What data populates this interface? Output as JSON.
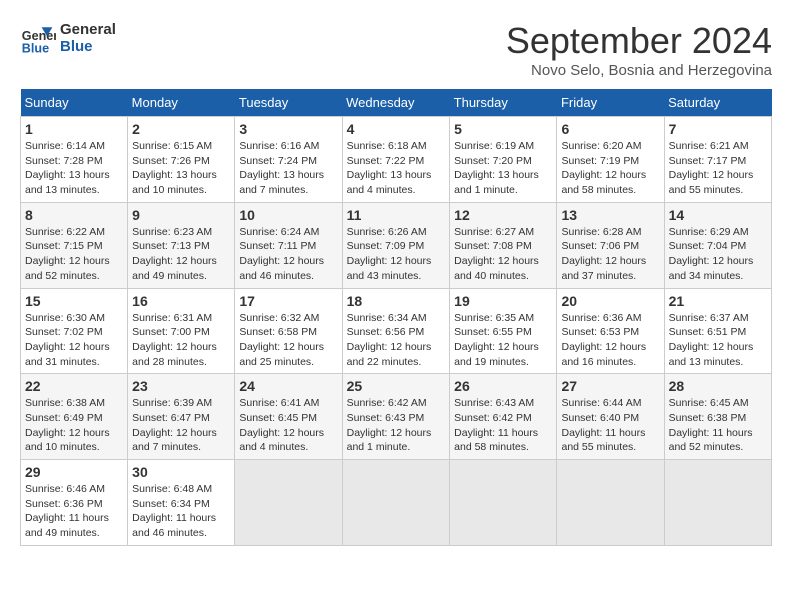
{
  "header": {
    "logo_general": "General",
    "logo_blue": "Blue",
    "title": "September 2024",
    "location": "Novo Selo, Bosnia and Herzegovina"
  },
  "weekdays": [
    "Sunday",
    "Monday",
    "Tuesday",
    "Wednesday",
    "Thursday",
    "Friday",
    "Saturday"
  ],
  "weeks": [
    [
      {
        "day": "1",
        "info": "Sunrise: 6:14 AM\nSunset: 7:28 PM\nDaylight: 13 hours\nand 13 minutes."
      },
      {
        "day": "2",
        "info": "Sunrise: 6:15 AM\nSunset: 7:26 PM\nDaylight: 13 hours\nand 10 minutes."
      },
      {
        "day": "3",
        "info": "Sunrise: 6:16 AM\nSunset: 7:24 PM\nDaylight: 13 hours\nand 7 minutes."
      },
      {
        "day": "4",
        "info": "Sunrise: 6:18 AM\nSunset: 7:22 PM\nDaylight: 13 hours\nand 4 minutes."
      },
      {
        "day": "5",
        "info": "Sunrise: 6:19 AM\nSunset: 7:20 PM\nDaylight: 13 hours\nand 1 minute."
      },
      {
        "day": "6",
        "info": "Sunrise: 6:20 AM\nSunset: 7:19 PM\nDaylight: 12 hours\nand 58 minutes."
      },
      {
        "day": "7",
        "info": "Sunrise: 6:21 AM\nSunset: 7:17 PM\nDaylight: 12 hours\nand 55 minutes."
      }
    ],
    [
      {
        "day": "8",
        "info": "Sunrise: 6:22 AM\nSunset: 7:15 PM\nDaylight: 12 hours\nand 52 minutes."
      },
      {
        "day": "9",
        "info": "Sunrise: 6:23 AM\nSunset: 7:13 PM\nDaylight: 12 hours\nand 49 minutes."
      },
      {
        "day": "10",
        "info": "Sunrise: 6:24 AM\nSunset: 7:11 PM\nDaylight: 12 hours\nand 46 minutes."
      },
      {
        "day": "11",
        "info": "Sunrise: 6:26 AM\nSunset: 7:09 PM\nDaylight: 12 hours\nand 43 minutes."
      },
      {
        "day": "12",
        "info": "Sunrise: 6:27 AM\nSunset: 7:08 PM\nDaylight: 12 hours\nand 40 minutes."
      },
      {
        "day": "13",
        "info": "Sunrise: 6:28 AM\nSunset: 7:06 PM\nDaylight: 12 hours\nand 37 minutes."
      },
      {
        "day": "14",
        "info": "Sunrise: 6:29 AM\nSunset: 7:04 PM\nDaylight: 12 hours\nand 34 minutes."
      }
    ],
    [
      {
        "day": "15",
        "info": "Sunrise: 6:30 AM\nSunset: 7:02 PM\nDaylight: 12 hours\nand 31 minutes."
      },
      {
        "day": "16",
        "info": "Sunrise: 6:31 AM\nSunset: 7:00 PM\nDaylight: 12 hours\nand 28 minutes."
      },
      {
        "day": "17",
        "info": "Sunrise: 6:32 AM\nSunset: 6:58 PM\nDaylight: 12 hours\nand 25 minutes."
      },
      {
        "day": "18",
        "info": "Sunrise: 6:34 AM\nSunset: 6:56 PM\nDaylight: 12 hours\nand 22 minutes."
      },
      {
        "day": "19",
        "info": "Sunrise: 6:35 AM\nSunset: 6:55 PM\nDaylight: 12 hours\nand 19 minutes."
      },
      {
        "day": "20",
        "info": "Sunrise: 6:36 AM\nSunset: 6:53 PM\nDaylight: 12 hours\nand 16 minutes."
      },
      {
        "day": "21",
        "info": "Sunrise: 6:37 AM\nSunset: 6:51 PM\nDaylight: 12 hours\nand 13 minutes."
      }
    ],
    [
      {
        "day": "22",
        "info": "Sunrise: 6:38 AM\nSunset: 6:49 PM\nDaylight: 12 hours\nand 10 minutes."
      },
      {
        "day": "23",
        "info": "Sunrise: 6:39 AM\nSunset: 6:47 PM\nDaylight: 12 hours\nand 7 minutes."
      },
      {
        "day": "24",
        "info": "Sunrise: 6:41 AM\nSunset: 6:45 PM\nDaylight: 12 hours\nand 4 minutes."
      },
      {
        "day": "25",
        "info": "Sunrise: 6:42 AM\nSunset: 6:43 PM\nDaylight: 12 hours\nand 1 minute."
      },
      {
        "day": "26",
        "info": "Sunrise: 6:43 AM\nSunset: 6:42 PM\nDaylight: 11 hours\nand 58 minutes."
      },
      {
        "day": "27",
        "info": "Sunrise: 6:44 AM\nSunset: 6:40 PM\nDaylight: 11 hours\nand 55 minutes."
      },
      {
        "day": "28",
        "info": "Sunrise: 6:45 AM\nSunset: 6:38 PM\nDaylight: 11 hours\nand 52 minutes."
      }
    ],
    [
      {
        "day": "29",
        "info": "Sunrise: 6:46 AM\nSunset: 6:36 PM\nDaylight: 11 hours\nand 49 minutes."
      },
      {
        "day": "30",
        "info": "Sunrise: 6:48 AM\nSunset: 6:34 PM\nDaylight: 11 hours\nand 46 minutes."
      },
      {
        "day": "",
        "info": ""
      },
      {
        "day": "",
        "info": ""
      },
      {
        "day": "",
        "info": ""
      },
      {
        "day": "",
        "info": ""
      },
      {
        "day": "",
        "info": ""
      }
    ]
  ]
}
